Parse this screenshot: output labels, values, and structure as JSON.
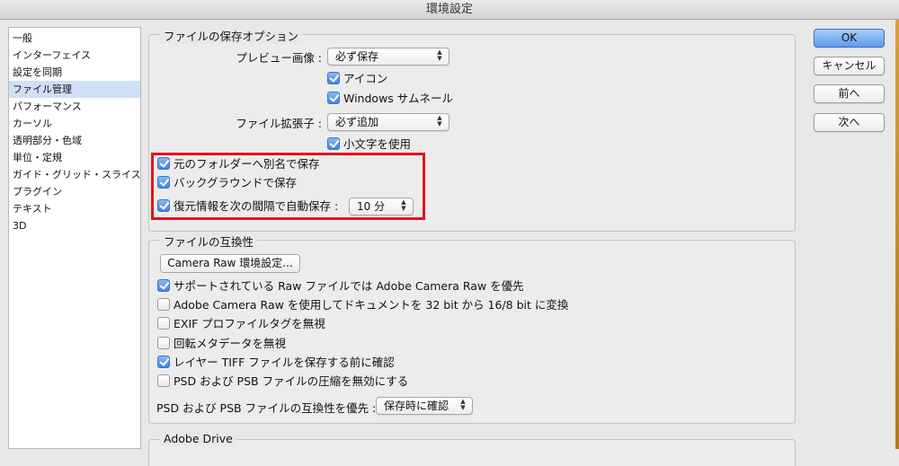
{
  "window": {
    "title": "環境設定"
  },
  "sidebar": {
    "items": [
      {
        "label": "一般"
      },
      {
        "label": "インターフェイス"
      },
      {
        "label": "設定を同期"
      },
      {
        "label": "ファイル管理"
      },
      {
        "label": "パフォーマンス"
      },
      {
        "label": "カーソル"
      },
      {
        "label": "透明部分・色域"
      },
      {
        "label": "単位・定規"
      },
      {
        "label": "ガイド・グリッド・スライス"
      },
      {
        "label": "プラグイン"
      },
      {
        "label": "テキスト"
      },
      {
        "label": "3D"
      }
    ],
    "selected": "ファイル管理"
  },
  "save_options": {
    "title": "ファイルの保存オプション",
    "preview_label": "プレビュー画像 :",
    "preview_value": "必ず保存",
    "icon_label": "アイコン",
    "icon_checked": true,
    "thumb_label": "Windows サムネール",
    "thumb_checked": true,
    "ext_label": "ファイル拡張子 :",
    "ext_value": "必ず追加",
    "lowercase_label": "小文字を使用",
    "lowercase_checked": true,
    "altname_label": "元のフォルダーへ別名で保存",
    "altname_checked": true,
    "background_label": "バックグラウンドで保存",
    "background_checked": true,
    "autosave_label": "復元情報を次の間隔で自動保存 :",
    "autosave_checked": true,
    "autosave_value": "10 分"
  },
  "compat": {
    "title": "ファイルの互換性",
    "camera_raw_button": "Camera Raw 環境設定...",
    "opt1_label": "サポートされている Raw ファイルでは Adobe Camera Raw を優先",
    "opt1_checked": true,
    "opt2_label": "Adobe Camera Raw を使用してドキュメントを 32 bit から 16/8 bit に変換",
    "opt2_checked": false,
    "opt3_label": "EXIF プロファイルタグを無視",
    "opt3_checked": false,
    "opt4_label": "回転メタデータを無視",
    "opt4_checked": false,
    "opt5_label": "レイヤー TIFF ファイルを保存する前に確認",
    "opt5_checked": true,
    "opt6_label": "PSD および PSB ファイルの圧縮を無効にする",
    "opt6_checked": false,
    "psd_label": "PSD および PSB ファイルの互換性を優先 :",
    "psd_value": "保存時に確認"
  },
  "drive": {
    "title": "Adobe Drive"
  },
  "buttons": {
    "ok": "OK",
    "cancel": "キャンセル",
    "prev": "前へ",
    "next": "次へ"
  },
  "colors": {
    "highlight": "#e3141b",
    "accent": "#3d83e3"
  }
}
